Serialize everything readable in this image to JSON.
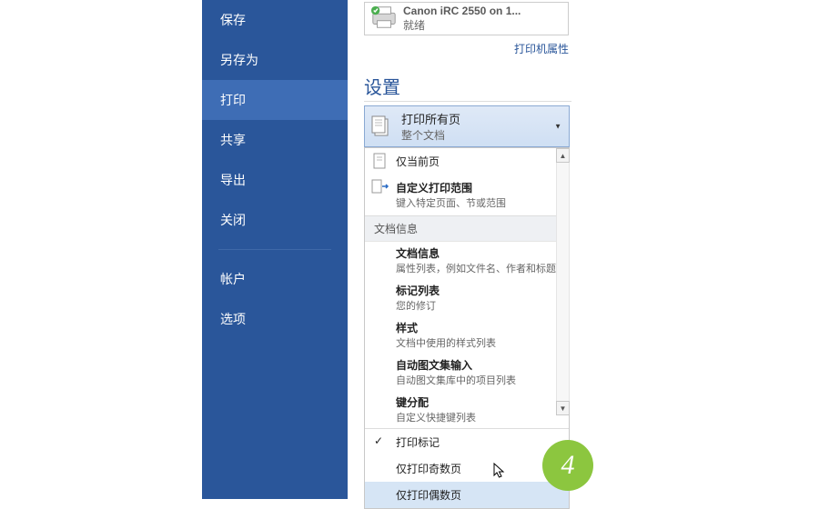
{
  "sidebar": {
    "items": [
      {
        "label": "保存"
      },
      {
        "label": "另存为"
      },
      {
        "label": "打印"
      },
      {
        "label": "共享"
      },
      {
        "label": "导出"
      },
      {
        "label": "关闭"
      }
    ],
    "account": "帐户",
    "options": "选项"
  },
  "printer": {
    "name": "Canon iRC 2550 on 1...",
    "status": "就绪",
    "props_link": "打印机属性"
  },
  "settings_head": "设置",
  "selected": {
    "title": "打印所有页",
    "subtitle": "整个文档"
  },
  "menu": {
    "current_page": "仅当前页",
    "custom": {
      "title": "自定义打印范围",
      "subtitle": "键入特定页面、节或范围"
    },
    "group_head": "文档信息",
    "docinfo": {
      "title": "文档信息",
      "subtitle": "属性列表，例如文件名、作者和标题"
    },
    "marklist": {
      "title": "标记列表",
      "subtitle": "您的修订"
    },
    "styles": {
      "title": "样式",
      "subtitle": "文档中使用的样式列表"
    },
    "autotext": {
      "title": "自动图文集输入",
      "subtitle": "自动图文集库中的项目列表"
    },
    "keys": {
      "title": "键分配",
      "subtitle": "自定义快捷键列表"
    },
    "print_marks": "打印标记",
    "odd": "仅打印奇数页",
    "even": "仅打印偶数页"
  },
  "badge_num": "4"
}
